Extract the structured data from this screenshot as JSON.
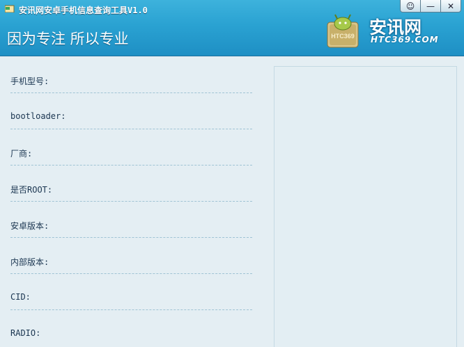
{
  "window": {
    "title": "安讯网安卓手机信息查询工具V1.0",
    "slogan": "因为专注 所以专业",
    "controls": [
      {
        "name": "feedback-icon",
        "glyph": "☺"
      },
      {
        "name": "minimize-icon",
        "glyph": "—"
      },
      {
        "name": "close-icon",
        "glyph": "✕"
      }
    ]
  },
  "logo": {
    "name": "安讯网",
    "url": "HTC369.COM",
    "badge_text": "HTC369"
  },
  "fields": [
    {
      "label": "手机型号:",
      "value": ""
    },
    {
      "label": "bootloader:",
      "value": ""
    },
    {
      "label": "厂商:",
      "value": ""
    },
    {
      "label": "是否ROOT:",
      "value": ""
    },
    {
      "label": "安卓版本:",
      "value": ""
    },
    {
      "label": "内部版本:",
      "value": ""
    },
    {
      "label": "CID:",
      "value": ""
    },
    {
      "label": "RADIO:",
      "value": ""
    }
  ],
  "colors": {
    "header": "#2aa2d2",
    "body": "#e4eef3",
    "separator": "#9fc3d4"
  }
}
